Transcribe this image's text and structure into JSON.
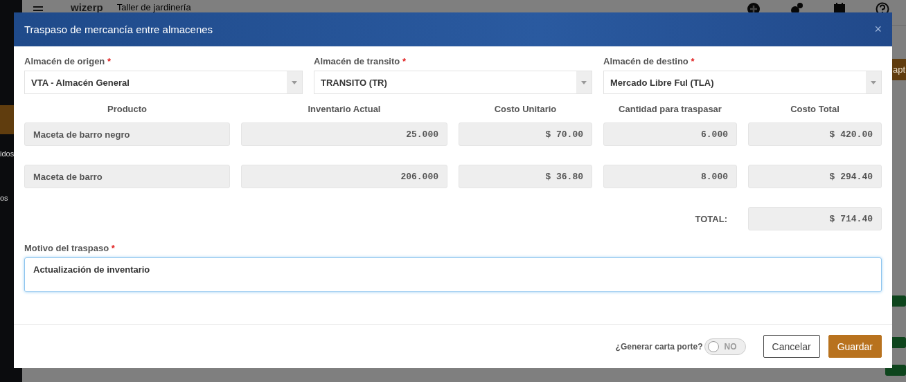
{
  "app": {
    "logo": "wizerp",
    "title": "Taller de jardinería",
    "sidebar_fragments": [
      "idos",
      "os"
    ],
    "action_fragment": "apt"
  },
  "dialog": {
    "title": "Traspaso de mercancía entre almacenes",
    "close": "×",
    "selects": [
      {
        "label": "Almacén de origen",
        "required": "*",
        "value": "VTA - Almacén General"
      },
      {
        "label": "Almacén de transito",
        "required": "*",
        "value": "TRANSITO (TR)"
      },
      {
        "label": "Almacén de destino",
        "required": "*",
        "value": "Mercado Libre Ful (TLA)"
      }
    ],
    "table": {
      "columns": [
        "Producto",
        "Inventario Actual",
        "Costo Unitario",
        "Cantidad para traspasar",
        "Costo Total"
      ],
      "rows": [
        [
          "Maceta de barro negro",
          "25.000",
          "$ 70.00",
          "6.000",
          "$ 420.00"
        ],
        [
          "Maceta de barro",
          "206.000",
          "$ 36.80",
          "8.000",
          "$ 294.40"
        ]
      ],
      "total_label": "TOTAL:",
      "total": "$ 714.40"
    },
    "reason": {
      "label": "Motivo del traspaso",
      "required": "*",
      "value": "Actualización de inventario"
    },
    "toggle": {
      "label": "¿Generar carta porte?",
      "on": false,
      "text": "NO"
    },
    "buttons": [
      {
        "kind": "secondary",
        "label": "Cancelar"
      },
      {
        "kind": "primary",
        "label": "Guardar"
      }
    ]
  }
}
